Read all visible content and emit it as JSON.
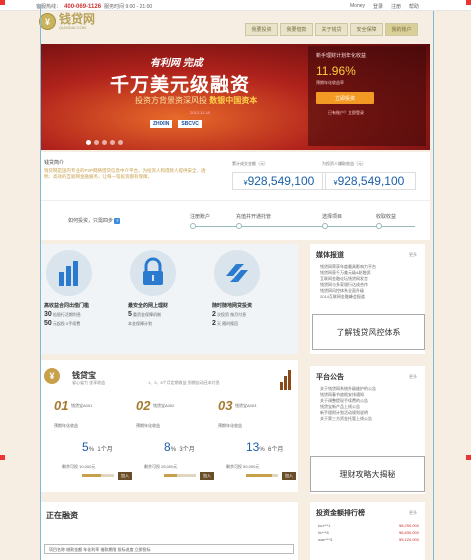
{
  "topbar": {
    "hotline_label": "客服热线：",
    "hotline": "400-069-1126",
    "hours": "服务时间 9:00 - 21:00",
    "links": [
      "Money",
      "登录",
      "注册",
      "帮助"
    ]
  },
  "logo": {
    "glyph": "¥",
    "name": "钱贷网",
    "sub": "QIANDAI.COM"
  },
  "nav": {
    "items": [
      "我要投资",
      "我要借款",
      "关于钱贷",
      "安全保障",
      "我的账户"
    ]
  },
  "banner": {
    "t1": "有利网 完成",
    "t2": "千万美元级融资",
    "t3_prefix": "投资方背景资深风投",
    "t3_em": "数银中国资本",
    "date": "2013.11.18",
    "logos": [
      "ZHIXIN",
      "SBCVC"
    ],
    "promo": {
      "title": "新手理财计划年化收益",
      "rate": "11.96%",
      "rate_label": "预期年化收益率",
      "button": "立即投资",
      "link": "已有账户？立即登录"
    }
  },
  "stats": {
    "intro_title": "钱贷简介",
    "intro": "钱贷网是国内专业的P2P网络借贷信息中介平台，为投资人和借款人提供安全、透明、高效的互联网金融服务，让每一笔投资都有保障。",
    "box1_label": "累计成交金额（元）",
    "box1_value": "928,549,100",
    "box2_label": "为投资人赚取收益（元）",
    "box2_value": "928,549,100",
    "currency": "¥"
  },
  "process": {
    "question": "如何投资，只需四步",
    "badge": "?",
    "steps": [
      "注册账户",
      "充值并开通托管",
      "选择项目",
      "收取收益"
    ]
  },
  "features": [
    {
      "title": "高收益合同出借门槛",
      "line1_big": "30",
      "line1": "倍银行活期利息",
      "line2_big": "50",
      "line2": "元起投 0手续费"
    },
    {
      "title": "最安全的网上理财",
      "line1_big": "5",
      "line1": "重资金保障机制",
      "line2_big": "",
      "line2": "本金保障计划"
    },
    {
      "title": "随时随地网贷投资",
      "line1_big": "2",
      "line1": "次投资 按月付息",
      "line2_big": "2",
      "line2": "天 随时赎回"
    }
  ],
  "media": {
    "title": "媒体报道",
    "more": "更多",
    "items": [
      "钱贷网荣获年度最具影响力平台",
      "钱贷网获千万美元级A轮融资",
      "互联网金融论坛钱贷网发言",
      "钱贷网与多家银行达成合作",
      "钱贷网风控体系全面升级",
      "2014互联网金融峰会报道"
    ],
    "ad": "了解钱贷风控体系"
  },
  "bao": {
    "glyph": "¥",
    "title": "钱贷宝",
    "subtitle": "省心省力 坐享收益",
    "note": "1、3、6个月定期收益 到期自动还本付息",
    "products": [
      {
        "num": "01",
        "name": "钱贷宝A001",
        "desc": "预期年化收益",
        "rate": "5",
        "term": "1个月",
        "meta": "剩余可投 10,000元",
        "btn": "加入",
        "progress": 0.6
      },
      {
        "num": "02",
        "name": "钱贷宝A002",
        "desc": "预期年化收益",
        "rate": "8",
        "term": "3个月",
        "meta": "剩余可投 25,000元",
        "btn": "加入",
        "progress": 0.4
      },
      {
        "num": "03",
        "name": "钱贷宝A003",
        "desc": "预期年化收益",
        "rate": "13",
        "term": "6个月",
        "meta": "剩余可投 50,000元",
        "btn": "加入",
        "progress": 0.8
      }
    ],
    "percent": "%"
  },
  "notice": {
    "title": "平台公告",
    "more": "更多",
    "items": [
      "关于钱贷网系统升级维护的公告",
      "钱贷网春节放假安排通知",
      "关于调整提现手续费的公告",
      "钱贷宝新产品上线公告",
      "新手理财计划活动规则说明",
      "关于第三方资金托管上线公告"
    ],
    "ad": "理财攻略大揭秘"
  },
  "financing": {
    "title": "正在融资",
    "row": "项目名称  借款金额  年化利率  借款期限  投标进度  立即投标"
  },
  "rank": {
    "title": "投资金额排行榜",
    "more": "更多",
    "items": [
      {
        "user": "tou***1",
        "amount": "¥8,250,000"
      },
      {
        "user": "lic***8",
        "amount": "¥6,830,000"
      },
      {
        "user": "wan***3",
        "amount": "¥5,120,000"
      }
    ]
  }
}
